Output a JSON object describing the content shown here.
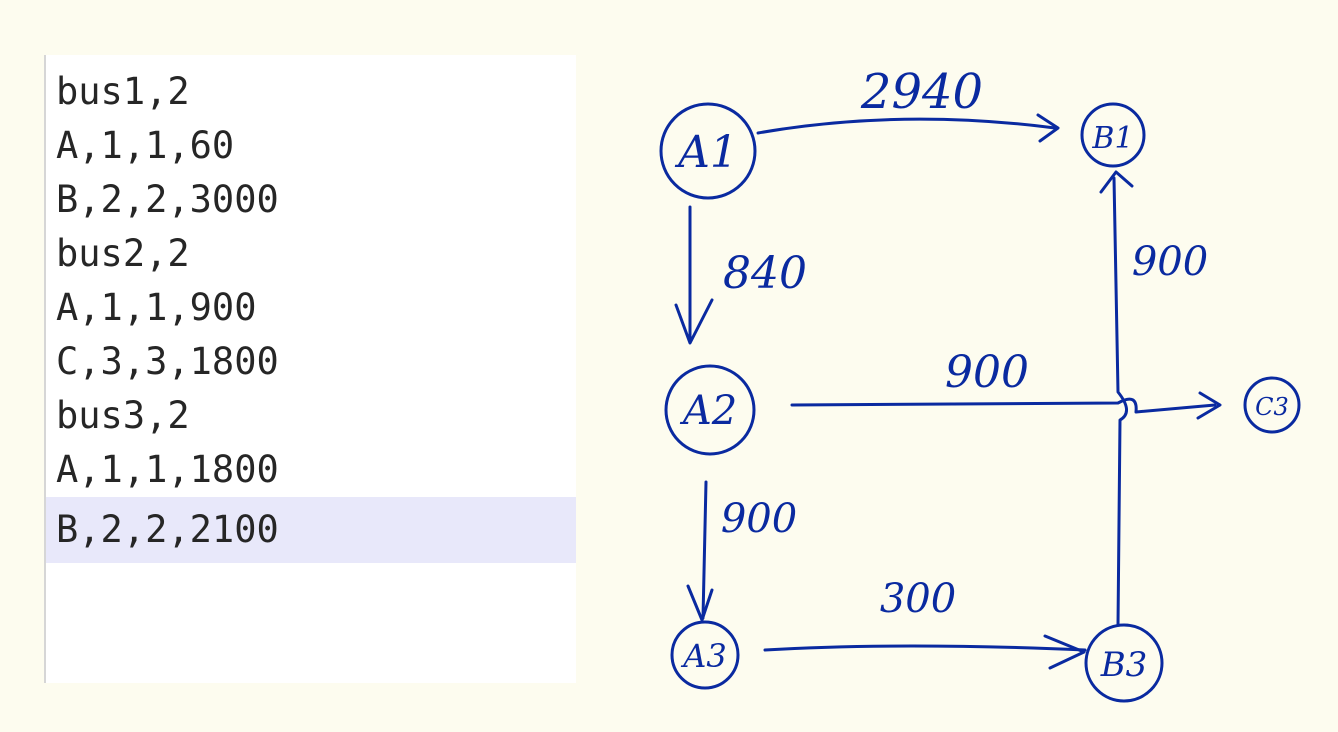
{
  "editor": {
    "lines": [
      "bus1,2",
      "A,1,1,60",
      "B,2,2,3000",
      "bus2,2",
      "A,1,1,900",
      "C,3,3,1800",
      "bus3,2",
      "A,1,1,1800",
      "B,2,2,2100"
    ],
    "current_line": 8
  },
  "diagram": {
    "ink_color": "#0a2aa0",
    "nodes": {
      "a1": "A1",
      "a2": "A2",
      "a3": "A3",
      "b1": "B1",
      "b3": "B3",
      "c3": "C3"
    },
    "edges": {
      "a1_b1": "2940",
      "a1_a2": "840",
      "a2_c3": "900",
      "a2_a3": "900",
      "a3_b3": "300",
      "b3_b1": "900"
    }
  }
}
